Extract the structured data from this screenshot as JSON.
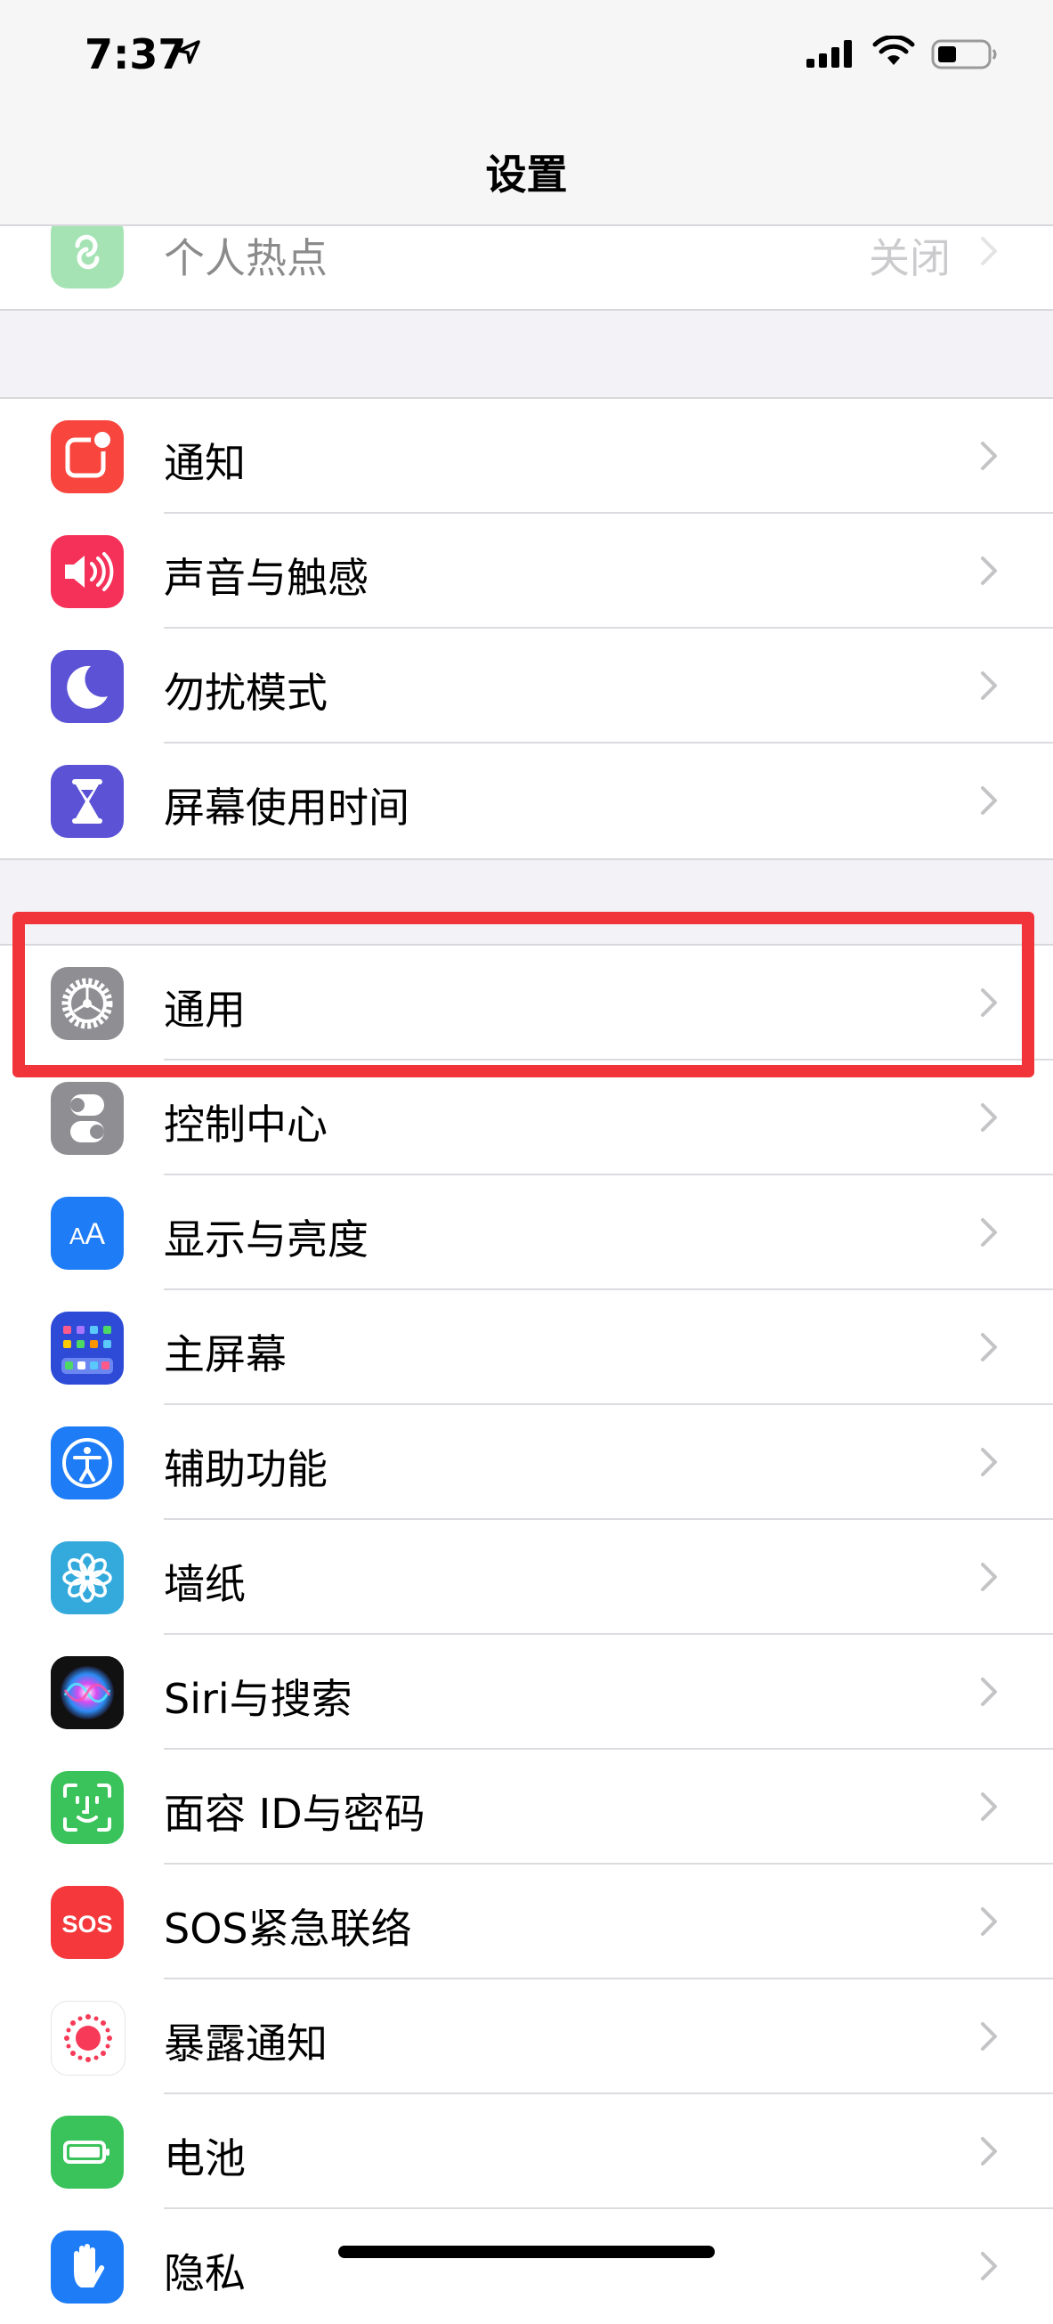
{
  "status_bar": {
    "time": "7:37"
  },
  "nav": {
    "title": "设置"
  },
  "hotspot": {
    "label": "个人热点",
    "value": "关闭"
  },
  "group1": [
    {
      "label": "通知",
      "icon": "notifications-icon",
      "color": "#f8453e"
    },
    {
      "label": "声音与触感",
      "icon": "speaker-icon",
      "color": "#f63159"
    },
    {
      "label": "勿扰模式",
      "icon": "moon-icon",
      "color": "#5b52d6"
    },
    {
      "label": "屏幕使用时间",
      "icon": "hourglass-icon",
      "color": "#5b52d6"
    }
  ],
  "group2": [
    {
      "label": "通用",
      "icon": "gear-icon",
      "color": "#8e8e93"
    },
    {
      "label": "控制中心",
      "icon": "toggles-icon",
      "color": "#8e8e93"
    },
    {
      "label": "显示与亮度",
      "icon": "text-size-icon",
      "color": "#1e7cf6"
    },
    {
      "label": "主屏幕",
      "icon": "home-grid-icon",
      "color": "#2d4bd6"
    },
    {
      "label": "辅助功能",
      "icon": "accessibility-icon",
      "color": "#1e7cf6"
    },
    {
      "label": "墙纸",
      "icon": "flower-icon",
      "color": "#34aadc"
    },
    {
      "label": "Siri与搜索",
      "icon": "siri-icon",
      "color": "#1a1a2e"
    },
    {
      "label": "面容 ID与密码",
      "icon": "face-id-icon",
      "color": "#3ac35a"
    },
    {
      "label": "SOS紧急联络",
      "icon": "sos-icon",
      "color": "#f4383b",
      "icon_text": "SOS"
    },
    {
      "label": "暴露通知",
      "icon": "exposure-icon",
      "color": "#ffffff"
    },
    {
      "label": "电池",
      "icon": "battery-icon",
      "color": "#3ac35a"
    },
    {
      "label": "隐私",
      "icon": "hand-icon",
      "color": "#1e7cf6"
    }
  ],
  "highlighted_item": "通用"
}
